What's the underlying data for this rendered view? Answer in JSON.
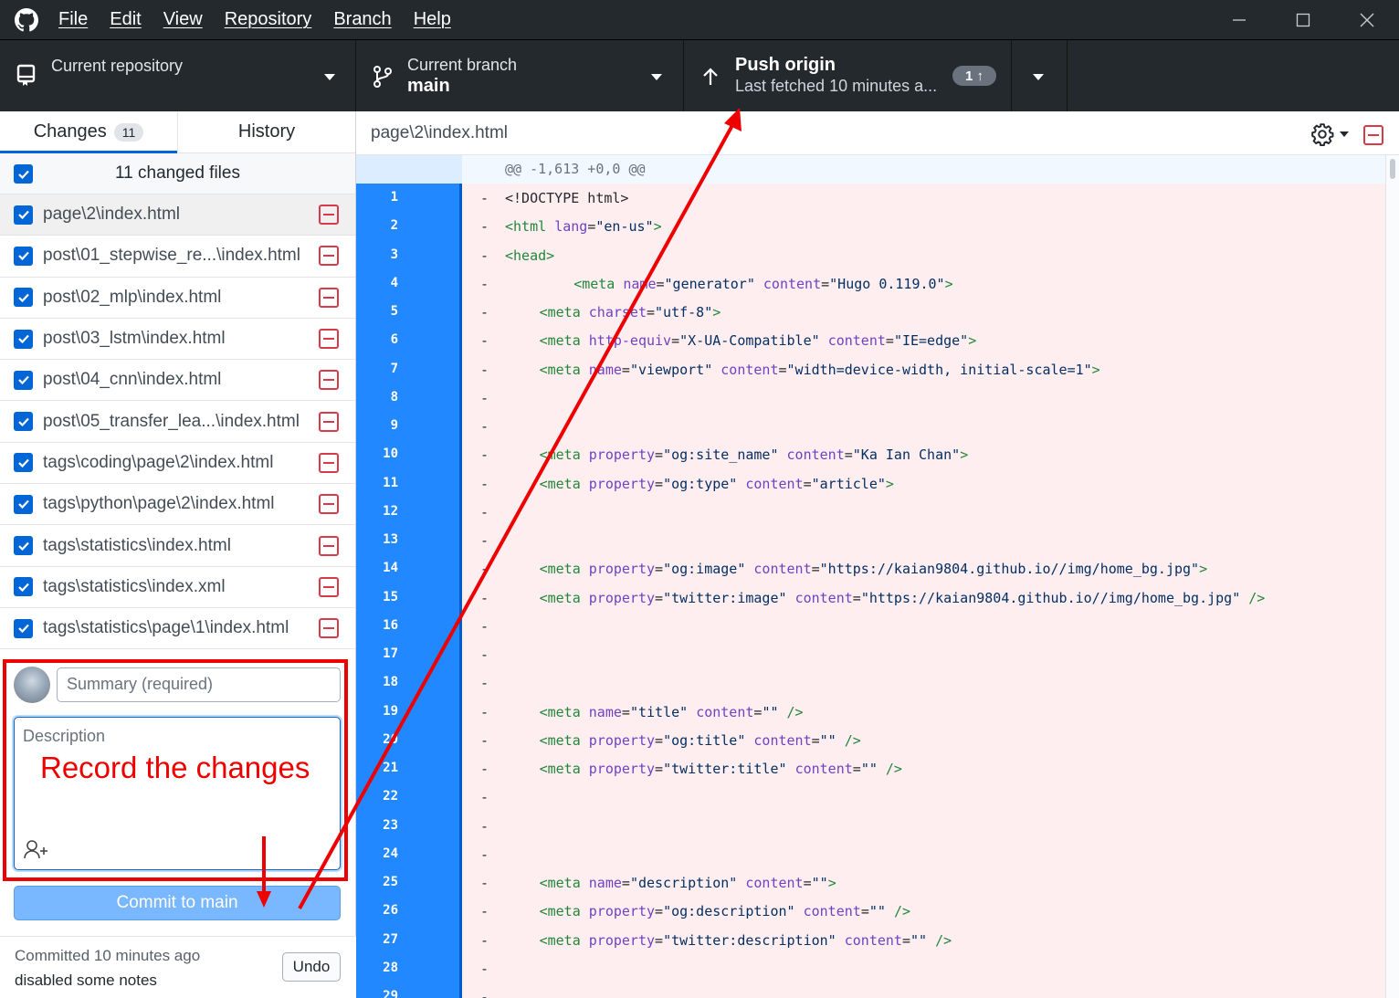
{
  "menu": [
    "File",
    "Edit",
    "View",
    "Repository",
    "Branch",
    "Help"
  ],
  "toolbar": {
    "repo_label": "Current repository",
    "branch_label": "Current branch",
    "branch_value": "main",
    "push_title": "Push origin",
    "push_sub": "Last fetched 10 minutes a...",
    "push_count": "1 ↑"
  },
  "tabs": {
    "changes": "Changes",
    "changes_count": "11",
    "history": "History"
  },
  "files_header": "11 changed files",
  "files": [
    "page\\2\\index.html",
    "post\\01_stepwise_re...\\index.html",
    "post\\02_mlp\\index.html",
    "post\\03_lstm\\index.html",
    "post\\04_cnn\\index.html",
    "post\\05_transfer_lea...\\index.html",
    "tags\\coding\\page\\2\\index.html",
    "tags\\python\\page\\2\\index.html",
    "tags\\statistics\\index.html",
    "tags\\statistics\\index.xml",
    "tags\\statistics\\page\\1\\index.html"
  ],
  "commit": {
    "summary_placeholder": "Summary (required)",
    "description_placeholder": "Description",
    "button": "Commit to main",
    "last_time": "Committed 10 minutes ago",
    "last_msg": "disabled some notes",
    "undo": "Undo"
  },
  "annotation": "Record the changes",
  "diff": {
    "path": "page\\2\\index.html",
    "hunk": "@@ -1,613 +0,0 @@",
    "lines": [
      {
        "n": "1",
        "indent": 0,
        "code": [
          [
            "t",
            "<!DOCTYPE html>"
          ]
        ]
      },
      {
        "n": "2",
        "indent": 0,
        "code": [
          [
            "g",
            "<html "
          ],
          [
            "a",
            "lang"
          ],
          [
            "t",
            "="
          ],
          [
            "s",
            "\"en-us\""
          ],
          [
            "g",
            ">"
          ]
        ]
      },
      {
        "n": "3",
        "indent": 0,
        "code": [
          [
            "g",
            "<head>"
          ]
        ]
      },
      {
        "n": "4",
        "indent": 8,
        "code": [
          [
            "g",
            "<meta "
          ],
          [
            "a",
            "name"
          ],
          [
            "t",
            "="
          ],
          [
            "s",
            "\"generator\" "
          ],
          [
            "a",
            "content"
          ],
          [
            "t",
            "="
          ],
          [
            "s",
            "\"Hugo 0.119.0\""
          ],
          [
            "g",
            ">"
          ]
        ]
      },
      {
        "n": "5",
        "indent": 4,
        "code": [
          [
            "g",
            "<meta "
          ],
          [
            "a",
            "charset"
          ],
          [
            "t",
            "="
          ],
          [
            "s",
            "\"utf-8\""
          ],
          [
            "g",
            ">"
          ]
        ]
      },
      {
        "n": "6",
        "indent": 4,
        "code": [
          [
            "g",
            "<meta "
          ],
          [
            "a",
            "http-equiv"
          ],
          [
            "t",
            "="
          ],
          [
            "s",
            "\"X-UA-Compatible\" "
          ],
          [
            "a",
            "content"
          ],
          [
            "t",
            "="
          ],
          [
            "s",
            "\"IE=edge\""
          ],
          [
            "g",
            ">"
          ]
        ]
      },
      {
        "n": "7",
        "indent": 4,
        "code": [
          [
            "g",
            "<meta "
          ],
          [
            "a",
            "name"
          ],
          [
            "t",
            "="
          ],
          [
            "s",
            "\"viewport\" "
          ],
          [
            "a",
            "content"
          ],
          [
            "t",
            "="
          ],
          [
            "s",
            "\"width=device-width, initial-scale=1\""
          ],
          [
            "g",
            ">"
          ]
        ]
      },
      {
        "n": "8",
        "indent": 0,
        "code": []
      },
      {
        "n": "9",
        "indent": 0,
        "code": []
      },
      {
        "n": "10",
        "indent": 4,
        "code": [
          [
            "g",
            "<meta "
          ],
          [
            "a",
            "property"
          ],
          [
            "t",
            "="
          ],
          [
            "s",
            "\"og:site_name\" "
          ],
          [
            "a",
            "content"
          ],
          [
            "t",
            "="
          ],
          [
            "s",
            "\"Ka Ian Chan\""
          ],
          [
            "g",
            ">"
          ]
        ]
      },
      {
        "n": "11",
        "indent": 4,
        "code": [
          [
            "g",
            "<meta "
          ],
          [
            "a",
            "property"
          ],
          [
            "t",
            "="
          ],
          [
            "s",
            "\"og:type\" "
          ],
          [
            "a",
            "content"
          ],
          [
            "t",
            "="
          ],
          [
            "s",
            "\"article\""
          ],
          [
            "g",
            ">"
          ]
        ]
      },
      {
        "n": "12",
        "indent": 0,
        "code": []
      },
      {
        "n": "13",
        "indent": 0,
        "code": []
      },
      {
        "n": "14",
        "indent": 4,
        "code": [
          [
            "g",
            "<meta "
          ],
          [
            "a",
            "property"
          ],
          [
            "t",
            "="
          ],
          [
            "s",
            "\"og:image\" "
          ],
          [
            "a",
            "content"
          ],
          [
            "t",
            "="
          ],
          [
            "s",
            "\"https://kaian9804.github.io//img/home_bg.jpg\""
          ],
          [
            "g",
            ">"
          ]
        ]
      },
      {
        "n": "15",
        "indent": 4,
        "code": [
          [
            "g",
            "<meta "
          ],
          [
            "a",
            "property"
          ],
          [
            "t",
            "="
          ],
          [
            "s",
            "\"twitter:image\" "
          ],
          [
            "a",
            "content"
          ],
          [
            "t",
            "="
          ],
          [
            "s",
            "\"https://kaian9804.github.io//img/home_bg.jpg\" "
          ],
          [
            "g",
            "/>"
          ]
        ]
      },
      {
        "n": "16",
        "indent": 0,
        "code": []
      },
      {
        "n": "17",
        "indent": 0,
        "code": []
      },
      {
        "n": "18",
        "indent": 0,
        "code": []
      },
      {
        "n": "19",
        "indent": 4,
        "code": [
          [
            "g",
            "<meta "
          ],
          [
            "a",
            "name"
          ],
          [
            "t",
            "="
          ],
          [
            "s",
            "\"title\" "
          ],
          [
            "a",
            "content"
          ],
          [
            "t",
            "="
          ],
          [
            "s",
            "\"\" "
          ],
          [
            "g",
            "/>"
          ]
        ]
      },
      {
        "n": "20",
        "indent": 4,
        "code": [
          [
            "g",
            "<meta "
          ],
          [
            "a",
            "property"
          ],
          [
            "t",
            "="
          ],
          [
            "s",
            "\"og:title\" "
          ],
          [
            "a",
            "content"
          ],
          [
            "t",
            "="
          ],
          [
            "s",
            "\"\" "
          ],
          [
            "g",
            "/>"
          ]
        ]
      },
      {
        "n": "21",
        "indent": 4,
        "code": [
          [
            "g",
            "<meta "
          ],
          [
            "a",
            "property"
          ],
          [
            "t",
            "="
          ],
          [
            "s",
            "\"twitter:title\" "
          ],
          [
            "a",
            "content"
          ],
          [
            "t",
            "="
          ],
          [
            "s",
            "\"\" "
          ],
          [
            "g",
            "/>"
          ]
        ]
      },
      {
        "n": "22",
        "indent": 0,
        "code": []
      },
      {
        "n": "23",
        "indent": 0,
        "code": []
      },
      {
        "n": "24",
        "indent": 0,
        "code": []
      },
      {
        "n": "25",
        "indent": 4,
        "code": [
          [
            "g",
            "<meta "
          ],
          [
            "a",
            "name"
          ],
          [
            "t",
            "="
          ],
          [
            "s",
            "\"description\" "
          ],
          [
            "a",
            "content"
          ],
          [
            "t",
            "="
          ],
          [
            "s",
            "\"\""
          ],
          [
            "g",
            ">"
          ]
        ]
      },
      {
        "n": "26",
        "indent": 4,
        "code": [
          [
            "g",
            "<meta "
          ],
          [
            "a",
            "property"
          ],
          [
            "t",
            "="
          ],
          [
            "s",
            "\"og:description\" "
          ],
          [
            "a",
            "content"
          ],
          [
            "t",
            "="
          ],
          [
            "s",
            "\"\" "
          ],
          [
            "g",
            "/>"
          ]
        ]
      },
      {
        "n": "27",
        "indent": 4,
        "code": [
          [
            "g",
            "<meta "
          ],
          [
            "a",
            "property"
          ],
          [
            "t",
            "="
          ],
          [
            "s",
            "\"twitter:description\" "
          ],
          [
            "a",
            "content"
          ],
          [
            "t",
            "="
          ],
          [
            "s",
            "\"\" "
          ],
          [
            "g",
            "/>"
          ]
        ]
      },
      {
        "n": "28",
        "indent": 0,
        "code": []
      },
      {
        "n": "29",
        "indent": 0,
        "code": []
      }
    ]
  }
}
